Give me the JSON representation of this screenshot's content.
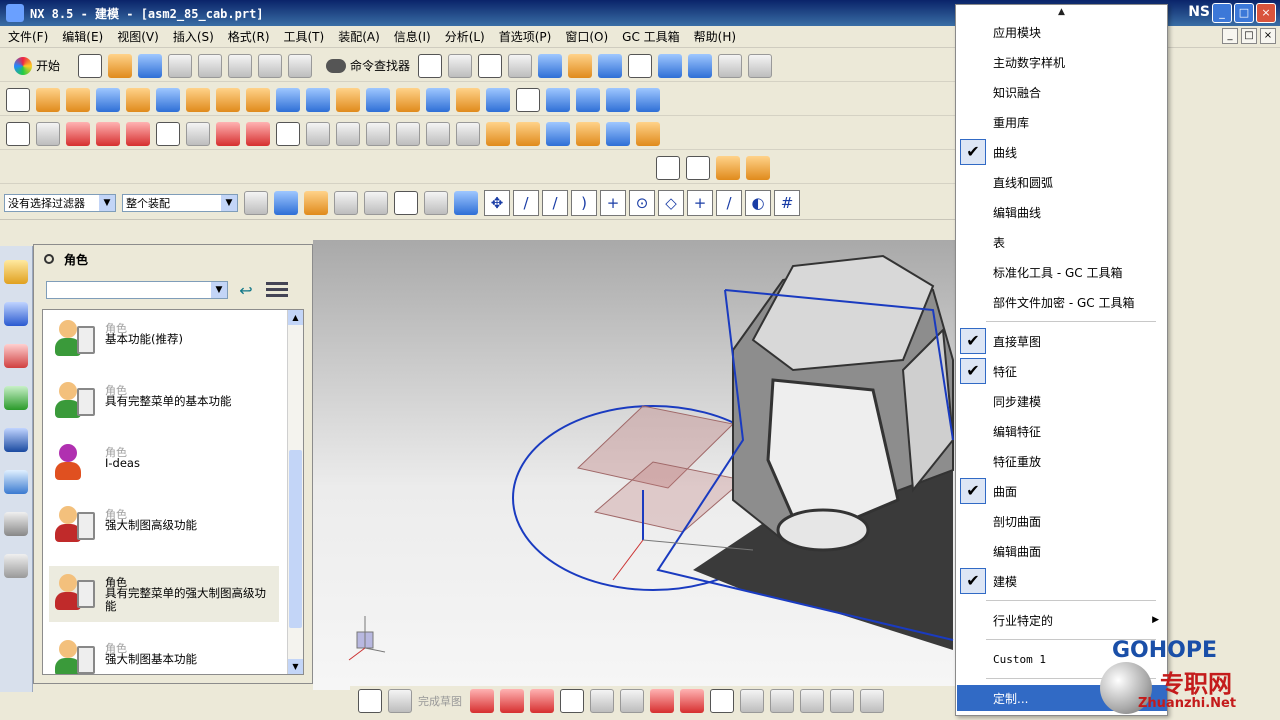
{
  "window": {
    "title": "NX 8.5 - 建模 - [asm2_85_cab.prt]",
    "brand_partial": "NS"
  },
  "menubar": {
    "items": [
      "文件(F)",
      "编辑(E)",
      "视图(V)",
      "插入(S)",
      "格式(R)",
      "工具(T)",
      "装配(A)",
      "信息(I)",
      "分析(L)",
      "首选项(P)",
      "窗口(O)",
      "GC 工具箱",
      "帮助(H)"
    ]
  },
  "toolbar": {
    "start_label": "开始",
    "command_finder_label": "命令查找器"
  },
  "filter": {
    "selection_filter": "没有选择过滤器",
    "assembly_scope": "整个装配"
  },
  "roles_panel": {
    "title": "角色",
    "roles": [
      {
        "category": "角色",
        "name": "基本功能(推荐)"
      },
      {
        "category": "角色",
        "name": "具有完整菜单的基本功能"
      },
      {
        "category": "角色",
        "name": "I-deas"
      },
      {
        "category": "角色",
        "name": "强大制图高级功能"
      },
      {
        "category": "角色",
        "name": "具有完整菜单的强大制图高级功能"
      },
      {
        "category": "角色",
        "name": "强大制图基本功能"
      }
    ]
  },
  "bottom_toolbar": {
    "finish_sketch_label": "完成草图"
  },
  "context_menu": {
    "items": [
      {
        "label": "应用模块",
        "checked": false
      },
      {
        "label": "主动数字样机",
        "checked": false
      },
      {
        "label": "知识融合",
        "checked": false
      },
      {
        "label": "重用库",
        "checked": false
      },
      {
        "label": "曲线",
        "checked": true
      },
      {
        "label": "直线和圆弧",
        "checked": false
      },
      {
        "label": "编辑曲线",
        "checked": false
      },
      {
        "label": "表",
        "checked": false
      },
      {
        "label": "标准化工具 - GC 工具箱",
        "checked": false
      },
      {
        "label": "部件文件加密 - GC 工具箱",
        "checked": false
      },
      {
        "label": "直接草图",
        "checked": true
      },
      {
        "label": "特征",
        "checked": true
      },
      {
        "label": "同步建模",
        "checked": false
      },
      {
        "label": "编辑特征",
        "checked": false
      },
      {
        "label": "特征重放",
        "checked": false
      },
      {
        "label": "曲面",
        "checked": true
      },
      {
        "label": "剖切曲面",
        "checked": false
      },
      {
        "label": "编辑曲面",
        "checked": false
      },
      {
        "label": "建模",
        "checked": true
      },
      {
        "label": "行业特定的",
        "checked": false
      },
      {
        "label": "Custom 1",
        "checked": false
      },
      {
        "label": "定制...",
        "checked": false
      }
    ]
  },
  "watermark": {
    "brand": "GOHOPE",
    "cn_text": "专职网",
    "url": "Zhuanzhi.Net"
  },
  "colors": {
    "accent": "#316ac5",
    "title_bar": "#0a246a",
    "sketch_line": "#1a3bc0"
  }
}
